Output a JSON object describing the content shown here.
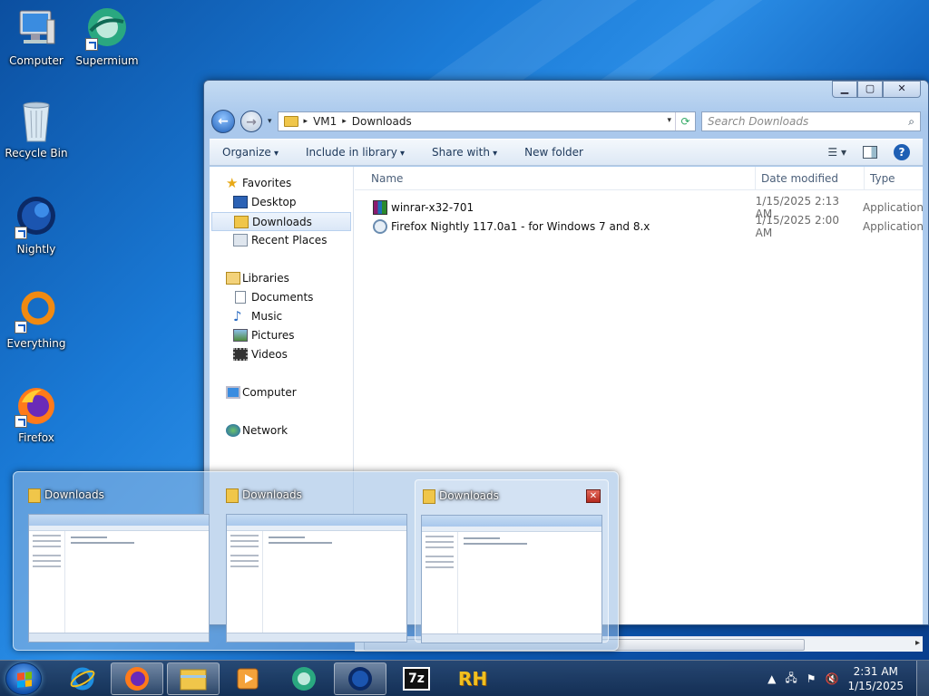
{
  "desktop": {
    "icons": [
      {
        "label": "Computer"
      },
      {
        "label": "Supermium"
      },
      {
        "label": "Recycle Bin"
      },
      {
        "label": "Nightly"
      },
      {
        "label": "Everything"
      },
      {
        "label": "Firefox"
      }
    ]
  },
  "explorer": {
    "address": {
      "segments": [
        "VM1",
        "Downloads"
      ]
    },
    "search": {
      "placeholder": "Search Downloads"
    },
    "toolbar": {
      "organize": "Organize",
      "include_library": "Include in library",
      "share_with": "Share with",
      "new_folder": "New folder"
    },
    "nav": {
      "favorites": "Favorites",
      "desktop": "Desktop",
      "downloads": "Downloads",
      "recent_places": "Recent Places",
      "libraries": "Libraries",
      "documents": "Documents",
      "music": "Music",
      "pictures": "Pictures",
      "videos": "Videos",
      "computer": "Computer",
      "network": "Network"
    },
    "columns": {
      "name": "Name",
      "date": "Date modified",
      "type": "Type"
    },
    "files": [
      {
        "name": "winrar-x32-701",
        "date": "1/15/2025 2:13 AM",
        "type": "Application"
      },
      {
        "name": "Firefox Nightly 117.0a1 - for Windows 7 and 8.x",
        "date": "1/15/2025 2:00 AM",
        "type": "Application"
      }
    ]
  },
  "preview": {
    "cards": [
      {
        "title": "Downloads"
      },
      {
        "title": "Downloads"
      },
      {
        "title": "Downloads"
      }
    ]
  },
  "taskbar": {
    "time": "2:31 AM",
    "date": "1/15/2025",
    "rh_label": "RH",
    "sevenzip_label": "7z"
  }
}
